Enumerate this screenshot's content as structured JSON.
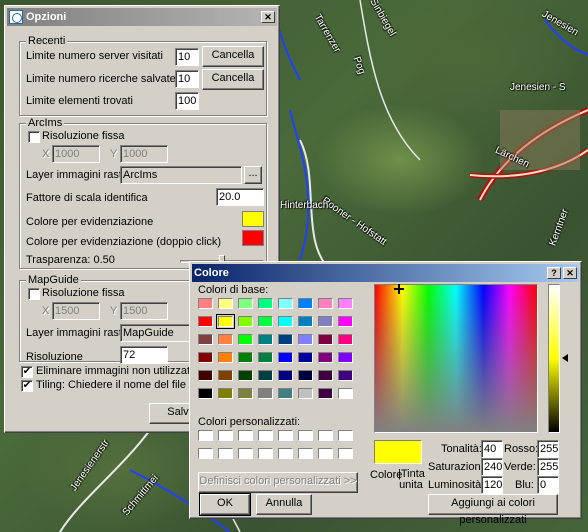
{
  "map": {
    "labels": [
      "Tarrenzer",
      "Pog",
      "Sinbiegel",
      "Jenesien - S",
      "Jenesien",
      "Lärchen",
      "Rooner - Hofstatt",
      "Kerntner",
      "Hinterbach",
      "Jenesienerstr",
      "Schmittmei"
    ]
  },
  "opzioni": {
    "title": "Opzioni",
    "close": "✕",
    "recenti": {
      "title": "Recenti",
      "server_label": "Limite numero server visitati",
      "server_value": "10",
      "search_label": "Limite numero ricerche salvate",
      "search_value": "10",
      "found_label": "Limite elementi trovati",
      "found_value": "100",
      "cancel1": "Cancella",
      "cancel2": "Cancella"
    },
    "arcims": {
      "title": "ArcIms",
      "fixed_res": "Risoluzione fissa",
      "x_label": "X",
      "x_value": "1000",
      "y_label": "Y",
      "y_value": "1000",
      "raster_label": "Layer immagini raster",
      "raster_value": "ArcIms",
      "browse": "...",
      "scale_label": "Fattore di scala identifica",
      "scale_value": "20.0",
      "highlight_label": "Colore per evidenziazione",
      "highlight_color": "#ffff00",
      "highlight2_label": "Colore per evidenziazione (doppio click)",
      "highlight2_color": "#ff0000",
      "transparency_label": "Trasparenza: 0.50",
      "transparency": 0.5
    },
    "mapguide": {
      "title": "MapGuide",
      "fixed_res": "Risoluzione fissa",
      "x_label": "X",
      "x_value": "1500",
      "y_label": "Y",
      "y_value": "1500",
      "raster_label": "Layer immagini raster",
      "raster_value": "MapGuide",
      "res_label": "Risoluzione",
      "res_value": "72"
    },
    "delete_unused": "Eliminare immagini non utilizzate",
    "tiling": "Tiling: Chiedere il nome del file",
    "save": "Salva"
  },
  "colore": {
    "title": "Colore",
    "help": "?",
    "close": "✕",
    "basic_label": "Colori di base:",
    "basic_colors": [
      "#ff8080",
      "#ffff80",
      "#80ff80",
      "#00ff80",
      "#80ffff",
      "#0080ff",
      "#ff80c0",
      "#ff80ff",
      "#ff0000",
      "#ffff00",
      "#80ff00",
      "#00ff40",
      "#00ffff",
      "#0080c0",
      "#8080c0",
      "#ff00ff",
      "#804040",
      "#ff8040",
      "#00ff00",
      "#008080",
      "#004080",
      "#8080ff",
      "#800040",
      "#ff0080",
      "#800000",
      "#ff8000",
      "#008000",
      "#008040",
      "#0000ff",
      "#0000a0",
      "#800080",
      "#8000ff",
      "#400000",
      "#804000",
      "#004000",
      "#004040",
      "#000080",
      "#000040",
      "#400040",
      "#400080",
      "#000000",
      "#808000",
      "#808040",
      "#808080",
      "#408080",
      "#c0c0c0",
      "#400040",
      "#ffffff"
    ],
    "selected_index": 9,
    "custom_label": "Colori personalizzati:",
    "define_custom": "Definisci colori personalizzati >>",
    "ok": "OK",
    "cancel": "Annulla",
    "color_solid_label": "Colore",
    "solid_label": "|Tinta unita",
    "current_color": "#ffff00",
    "hue_label": "Tonalità:",
    "hue_value": "40",
    "sat_label": "Saturazione:",
    "sat_value": "240",
    "lum_label": "Luminosità:",
    "lum_value": "120",
    "red_label": "Rosso:",
    "red_value": "255",
    "green_label": "Verde:",
    "green_value": "255",
    "blue_label": "Blu:",
    "blue_value": "0",
    "add_custom": "Aggiungi ai colori personalizzati"
  }
}
